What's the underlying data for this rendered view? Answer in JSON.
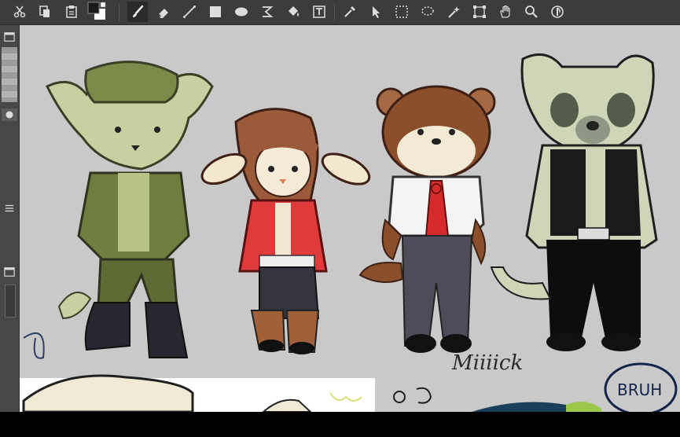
{
  "toolbar": {
    "tools": [
      {
        "name": "cut-icon"
      },
      {
        "name": "copy-icon"
      },
      {
        "name": "paste-icon"
      },
      {
        "name": "color-swatch"
      },
      {
        "name": "brush-icon"
      },
      {
        "name": "eraser-icon"
      },
      {
        "name": "line-icon"
      },
      {
        "name": "rectangle-icon"
      },
      {
        "name": "ellipse-icon"
      },
      {
        "name": "curve-icon"
      },
      {
        "name": "fill-bucket-icon"
      },
      {
        "name": "text-frame-icon"
      },
      {
        "name": "eyedropper-icon"
      },
      {
        "name": "move-icon"
      },
      {
        "name": "rect-select-icon"
      },
      {
        "name": "lasso-select-icon"
      },
      {
        "name": "magic-wand-icon"
      },
      {
        "name": "transform-icon"
      },
      {
        "name": "hand-icon"
      },
      {
        "name": "zoom-icon"
      },
      {
        "name": "rotate-view-icon"
      }
    ],
    "active_tool": "brush-icon",
    "colors": {
      "foreground": "#1a1a1a",
      "background": "#ffffff",
      "accent": "#3a3a3a"
    }
  },
  "canvas": {
    "background": "#c9c9c9",
    "scribble_text": "Miiiick",
    "speech_bubble_text": "BRUH"
  }
}
